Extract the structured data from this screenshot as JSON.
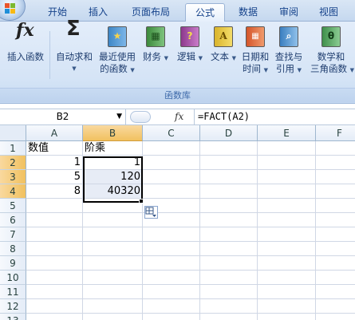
{
  "tabs": [
    "开始",
    "插入",
    "页面布局",
    "公式",
    "数据",
    "审阅",
    "视图"
  ],
  "active_tab": "公式",
  "ribbon": {
    "buttons": [
      {
        "label1": "插入函数",
        "label2": "",
        "icon": "fx-icon",
        "dropdown": false
      },
      {
        "label1": "自动求和",
        "label2": "",
        "icon": "sigma-icon",
        "dropdown": true
      },
      {
        "label1": "最近使用",
        "label2": "的函数",
        "icon": "recent-functions-book-icon",
        "dropdown": true
      },
      {
        "label1": "财务",
        "label2": "",
        "icon": "financial-book-icon",
        "dropdown": true
      },
      {
        "label1": "逻辑",
        "label2": "",
        "icon": "logical-book-icon",
        "dropdown": true
      },
      {
        "label1": "文本",
        "label2": "",
        "icon": "text-book-icon",
        "dropdown": true
      },
      {
        "label1": "日期和",
        "label2": "时间",
        "icon": "datetime-book-icon",
        "dropdown": true
      },
      {
        "label1": "查找与",
        "label2": "引用",
        "icon": "lookup-book-icon",
        "dropdown": true
      },
      {
        "label1": "数学和",
        "label2": "三角函数",
        "icon": "math-book-icon",
        "dropdown": true
      }
    ],
    "icon_glyphs": {
      "fx": "fx",
      "sigma": "Σ",
      "text": "A",
      "logical": "?",
      "math": "θ"
    },
    "group_label": "函数库"
  },
  "formula_bar": {
    "name_box": "B2",
    "fx_label": "fx",
    "formula": "=FACT(A2)"
  },
  "columns": [
    "A",
    "B",
    "C",
    "D",
    "E",
    "F"
  ],
  "selected_column": "B",
  "rows": [
    "1",
    "2",
    "3",
    "4",
    "5",
    "6",
    "7",
    "8",
    "9",
    "10",
    "11",
    "12",
    "13"
  ],
  "selected_rows": [
    "2",
    "3",
    "4"
  ],
  "cells": {
    "A1": "数值",
    "B1": "阶乘",
    "A2": "1",
    "B2": "1",
    "A3": "5",
    "B3": "120",
    "A4": "8",
    "B4": "40320"
  },
  "colors": {
    "accent": "#15428b",
    "selection_header": "#f1c15f",
    "grid": "#d0d7e5"
  }
}
